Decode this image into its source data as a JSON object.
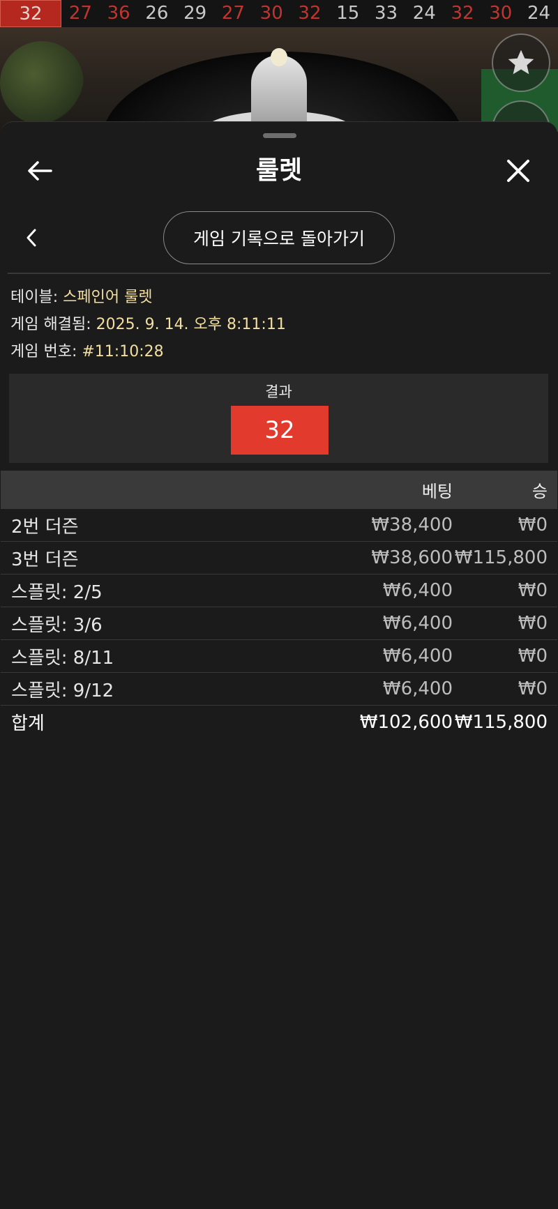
{
  "recent_numbers": [
    {
      "value": "32",
      "color": "red",
      "current": true
    },
    {
      "value": "27",
      "color": "red"
    },
    {
      "value": "36",
      "color": "red"
    },
    {
      "value": "26",
      "color": "black"
    },
    {
      "value": "29",
      "color": "black"
    },
    {
      "value": "27",
      "color": "red"
    },
    {
      "value": "30",
      "color": "red"
    },
    {
      "value": "32",
      "color": "red"
    },
    {
      "value": "15",
      "color": "black"
    },
    {
      "value": "33",
      "color": "black"
    },
    {
      "value": "24",
      "color": "black"
    },
    {
      "value": "32",
      "color": "red"
    },
    {
      "value": "30",
      "color": "red"
    },
    {
      "value": "24",
      "color": "black"
    }
  ],
  "colors": {
    "red_number": "#c0352f",
    "result_bg": "#e23b2d",
    "value_text": "#f3dfa0",
    "sheet_bg": "#1b1b1b"
  },
  "header": {
    "title": "룰렛",
    "back_icon": "arrow-left-icon",
    "close_icon": "close-icon"
  },
  "nav": {
    "back_to_history": "게임 기록으로 돌아가기",
    "chevron_icon": "chevron-left-icon"
  },
  "info": {
    "table_label": "테이블:",
    "table_value": "스페인어 룰렛",
    "resolved_label": "게임 해결됨:",
    "resolved_value": "2025. 9. 14. 오후 8:11:11",
    "game_no_label": "게임 번호:",
    "game_no_value": "#11:10:28"
  },
  "result": {
    "label": "결과",
    "number": "32"
  },
  "bets_table": {
    "headers": {
      "bet": "베팅",
      "win": "승"
    },
    "rows": [
      {
        "name": "2번 더즌",
        "bet": "₩38,400",
        "win": "₩0"
      },
      {
        "name": "3번 더즌",
        "bet": "₩38,600",
        "win": "₩115,800"
      },
      {
        "name": "스플릿: 2/5",
        "bet": "₩6,400",
        "win": "₩0"
      },
      {
        "name": "스플릿: 3/6",
        "bet": "₩6,400",
        "win": "₩0"
      },
      {
        "name": "스플릿: 8/11",
        "bet": "₩6,400",
        "win": "₩0"
      },
      {
        "name": "스플릿: 9/12",
        "bet": "₩6,400",
        "win": "₩0"
      }
    ],
    "total": {
      "name": "합계",
      "bet": "₩102,600",
      "win": "₩115,800"
    }
  }
}
